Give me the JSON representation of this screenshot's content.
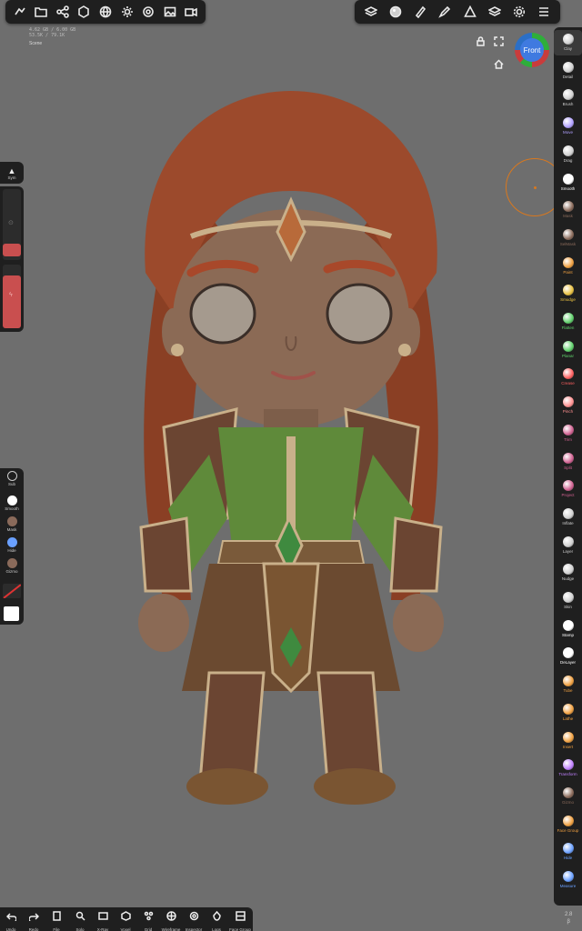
{
  "top_left_toolbar": {
    "icons": [
      "hand-draw-icon",
      "folder-icon",
      "share-icon",
      "scene-icon",
      "globe-icon",
      "light-icon",
      "material-icon",
      "image-icon",
      "video-icon"
    ]
  },
  "top_right_toolbar": {
    "icons": [
      "topology-icon",
      "matcap-sphere-icon",
      "brush-pen-icon",
      "paint-icon",
      "triangle-icon",
      "layers-icon",
      "settings-icon",
      "menu-icon"
    ]
  },
  "info": {
    "line1": "4.62 GB / 6.00 GB",
    "line2": "53.5K / 79.1K",
    "scene": "Scene"
  },
  "view": {
    "gizmo_label": "Front"
  },
  "left": {
    "sym_label": "Sym",
    "tools": [
      {
        "label": "Sub",
        "icon": "sub-icon"
      },
      {
        "label": "Smooth",
        "icon": "smooth-icon"
      },
      {
        "label": "Mask",
        "icon": "mask-icon"
      },
      {
        "label": "Hide",
        "icon": "hide-icon"
      },
      {
        "label": "Gizmo",
        "icon": "gizmo-icon"
      }
    ]
  },
  "right_tools": [
    {
      "label": "Clay",
      "color": "#cfcfcf"
    },
    {
      "label": "Detail",
      "color": "#cfcfcf"
    },
    {
      "label": "Brush",
      "color": "#cfcfcf"
    },
    {
      "label": "Move",
      "color": "#b0a0ff"
    },
    {
      "label": "Drag",
      "color": "#cfcfcf"
    },
    {
      "label": "Smooth",
      "color": "#ffffff"
    },
    {
      "label": "Mask",
      "color": "#8a6a5a"
    },
    {
      "label": "SelMask",
      "color": "#8a6a5a"
    },
    {
      "label": "Paint",
      "color": "#f0a040"
    },
    {
      "label": "Smudge",
      "color": "#e8c040"
    },
    {
      "label": "Flatten",
      "color": "#5fd06a"
    },
    {
      "label": "Planar",
      "color": "#5fd06a"
    },
    {
      "label": "Crease",
      "color": "#ff6060"
    },
    {
      "label": "Pinch",
      "color": "#ff9090"
    },
    {
      "label": "Trim",
      "color": "#d06090"
    },
    {
      "label": "Split",
      "color": "#d06090"
    },
    {
      "label": "Project",
      "color": "#d06090"
    },
    {
      "label": "Inflate",
      "color": "#cfcfcf"
    },
    {
      "label": "Layer",
      "color": "#cfcfcf"
    },
    {
      "label": "Nudge",
      "color": "#cfcfcf"
    },
    {
      "label": "Skin",
      "color": "#cfcfcf"
    },
    {
      "label": "Stamp",
      "color": "#ffffff"
    },
    {
      "label": "DeLayer",
      "color": "#ffffff"
    },
    {
      "label": "Tube",
      "color": "#f0a040"
    },
    {
      "label": "Lathe",
      "color": "#f0a040"
    },
    {
      "label": "Insert",
      "color": "#f0a040"
    },
    {
      "label": "Transform",
      "color": "#c080ff"
    },
    {
      "label": "Gizmo",
      "color": "#8a6a5a"
    },
    {
      "label": "Face Group",
      "color": "#f0a040"
    },
    {
      "label": "Hide",
      "color": "#6aa0ff"
    },
    {
      "label": "Measure",
      "color": "#6aa0ff"
    }
  ],
  "bottom_tools": [
    {
      "label": "Undo",
      "icon": "undo-icon"
    },
    {
      "label": "Redo",
      "icon": "redo-icon"
    },
    {
      "label": "File",
      "icon": "file-icon"
    },
    {
      "label": "Solo",
      "icon": "solo-icon"
    },
    {
      "label": "X-Ray",
      "icon": "xray-icon"
    },
    {
      "label": "Voxel",
      "icon": "voxel-icon"
    },
    {
      "label": "Grid",
      "icon": "grid-icon"
    },
    {
      "label": "Wireframe",
      "icon": "wireframe-icon"
    },
    {
      "label": "Inspector",
      "icon": "inspector-icon"
    },
    {
      "label": "Logs",
      "icon": "logs-icon"
    },
    {
      "label": "Face Group",
      "icon": "facegroup-icon"
    }
  ],
  "version": {
    "line1": "2.8",
    "line2": "β"
  }
}
